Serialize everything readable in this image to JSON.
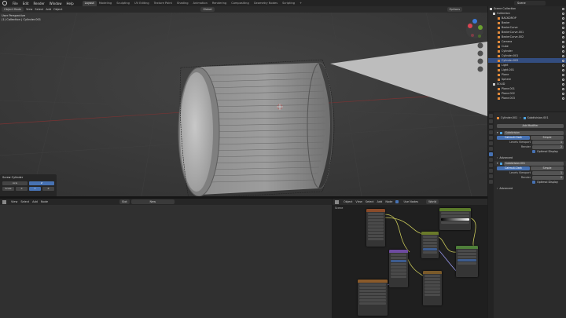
{
  "topbar": {
    "menus": [
      "File",
      "Edit",
      "Render",
      "Window",
      "Help"
    ],
    "workspaces": [
      "Layout",
      "Modeling",
      "Sculpting",
      "UV Editing",
      "Texture Paint",
      "Shading",
      "Animation",
      "Rendering",
      "Compositing",
      "Geometry Nodes",
      "Scripting"
    ],
    "scene": "Scene"
  },
  "viewport": {
    "header": {
      "mode": "Object Mode",
      "view": "View",
      "select": "Select",
      "add": "Add",
      "object": "Object",
      "global": "Global",
      "options": "Options"
    },
    "info_line1": "User Perspective",
    "info_line2": "(1) Collection | Cylinder.001",
    "tool_panel": {
      "title": "Screw Cylinder",
      "cells": [
        "Axis",
        "Z",
        "Scale",
        "X",
        "Y",
        "Z"
      ]
    }
  },
  "outliner": {
    "rows": [
      {
        "label": "Scene Collection",
        "sel": false,
        "color": "#cccccc"
      },
      {
        "label": "Collection",
        "sel": false,
        "color": "#cccccc"
      },
      {
        "label": "BACKDROP",
        "sel": false,
        "color": "#e08a3c"
      },
      {
        "label": "Bezier",
        "sel": false,
        "color": "#e08a3c"
      },
      {
        "label": "BezierCurve",
        "sel": false,
        "color": "#e08a3c"
      },
      {
        "label": "BezierCurve.001",
        "sel": false,
        "color": "#e08a3c"
      },
      {
        "label": "BezierCurve.002",
        "sel": false,
        "color": "#e08a3c"
      },
      {
        "label": "Camera",
        "sel": false,
        "color": "#e08a3c"
      },
      {
        "label": "Cube",
        "sel": false,
        "color": "#e08a3c"
      },
      {
        "label": "Cylinder",
        "sel": false,
        "color": "#e08a3c"
      },
      {
        "label": "Cylinder.001",
        "sel": false,
        "color": "#e08a3c"
      },
      {
        "label": "Cylinder.002",
        "sel": true,
        "color": "#e08a3c"
      },
      {
        "label": "Light",
        "sel": false,
        "color": "#e08a3c"
      },
      {
        "label": "Light.001",
        "sel": false,
        "color": "#e08a3c"
      },
      {
        "label": "Plane",
        "sel": false,
        "color": "#e08a3c"
      },
      {
        "label": "Sphere",
        "sel": false,
        "color": "#e08a3c"
      },
      {
        "label": "SOLID",
        "sel": false,
        "color": "#cccccc"
      },
      {
        "label": "Plane.001",
        "sel": false,
        "color": "#e08a3c"
      },
      {
        "label": "Plane.002",
        "sel": false,
        "color": "#e08a3c"
      },
      {
        "label": "Plane.003",
        "sel": false,
        "color": "#e08a3c"
      }
    ]
  },
  "properties": {
    "object_name": "Cylinder.001",
    "modifier_name": "Subdivision.001",
    "add_modifier": "Add Modifier",
    "mod1": {
      "name": "Subdivision",
      "tabs": [
        "Catmull-Clark",
        "Simple"
      ],
      "levels_viewport_label": "Levels Viewport",
      "levels_viewport": "1",
      "render_label": "Render",
      "render": "2",
      "optimal": "Optimal Display"
    },
    "advanced_label": "Advanced",
    "mod2": {
      "name": "Subdivision.001",
      "tabs": [
        "Catmull-Clark",
        "Simple"
      ],
      "levels_viewport_label": "Levels Viewport",
      "levels_viewport": "1",
      "render_label": "Render",
      "render": "2",
      "optimal": "Optimal Display"
    },
    "advanced2_label": "Advanced"
  },
  "left_editor": {
    "menus": [
      "View",
      "Select",
      "Add",
      "Node"
    ],
    "frame_label": "Slot",
    "frame_value": "New"
  },
  "node_editor": {
    "menus": [
      "Object",
      "View",
      "Select",
      "Add",
      "Node"
    ],
    "use_nodes": "Use Nodes",
    "slot": "World",
    "breadcrumb": "Scene"
  }
}
